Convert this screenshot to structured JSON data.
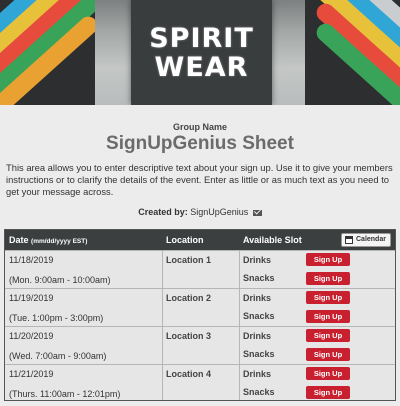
{
  "banner": {
    "logo_line1": "SPIRIT",
    "logo_line2": "WEAR",
    "shirt_colors": [
      "#2fa6d6",
      "#e8c13b",
      "#e64b3c",
      "#3aa35a",
      "#e9a232",
      "#c9cdd0"
    ]
  },
  "header": {
    "group_name": "Group Name",
    "sheet_title": "SignUpGenius Sheet"
  },
  "description": "This area allows you to enter descriptive text about your sign up. Use it to give your members instructions or to clarify the details of the event. Enter as little or as much text as you need to get your message across.",
  "created": {
    "label": "Created by:",
    "name": "SignUpGenius",
    "icon": "mail-icon"
  },
  "table": {
    "col_date": "Date",
    "col_date_format": "(mm/dd/yyyy EST)",
    "col_location": "Location",
    "col_slot": "Available Slot",
    "calendar_label": "Calendar",
    "signup_label": "Sign Up",
    "rows": [
      {
        "date": "11/18/2019",
        "time": "(Mon. 9:00am - 10:00am)",
        "location": "Location 1",
        "slot1": "Drinks",
        "slot2": "Snacks"
      },
      {
        "date": "11/19/2019",
        "time": "(Tue. 1:00pm - 3:00pm)",
        "location": "Location 2",
        "slot1": "Drinks",
        "slot2": "Snacks"
      },
      {
        "date": "11/20/2019",
        "time": "(Wed. 7:00am - 9:00am)",
        "location": "Location 3",
        "slot1": "Drinks",
        "slot2": "Snacks"
      },
      {
        "date": "11/21/2019",
        "time": "(Thurs. 11:00am - 12:01pm)",
        "location": "Location 4",
        "slot1": "Drinks",
        "slot2": "Snacks"
      }
    ]
  },
  "colors": {
    "signup_button": "#c8202f",
    "table_header": "#3c3f40",
    "page_background": "#ececec"
  }
}
